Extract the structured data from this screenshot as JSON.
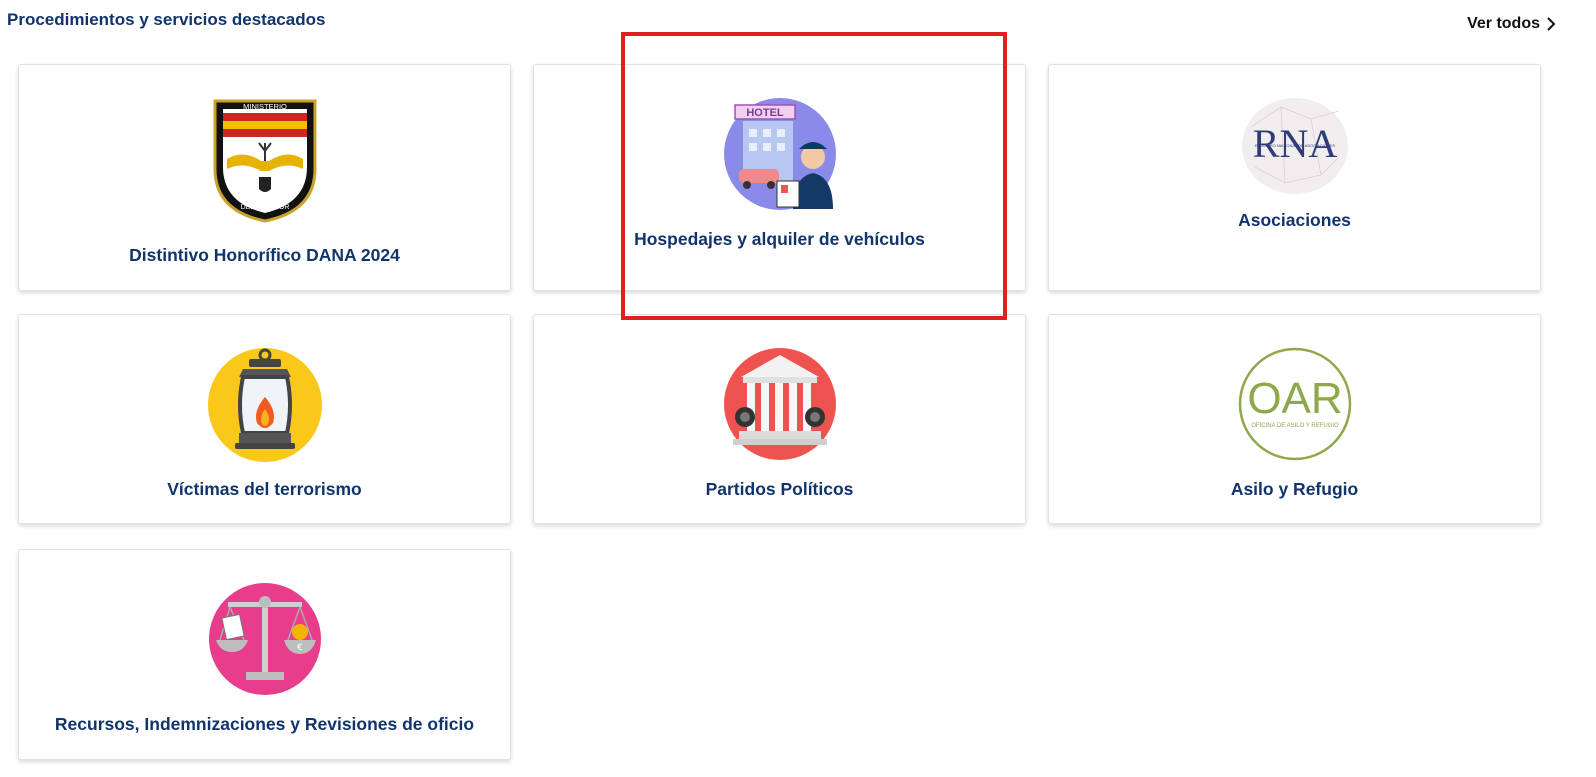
{
  "section": {
    "title": "Procedimientos y servicios destacados",
    "see_all": "Ver todos"
  },
  "cards": [
    {
      "label": "Distintivo Honorífico DANA 2024",
      "icon": "ministerio-interior-badge-icon",
      "badge_top": "MINISTERIO",
      "badge_bottom": "DEL INTERIOR"
    },
    {
      "label": "Hospedajes y alquiler de vehículos",
      "icon": "hotel-vehicle-icon",
      "sign": "HOTEL"
    },
    {
      "label": "Asociaciones",
      "icon": "rna-logo-icon",
      "logo_text": "RNA",
      "logo_sub": "REGISTRO NACIONAL DE ASOCIACIONES"
    },
    {
      "label": "Víctimas del terrorismo",
      "icon": "lantern-icon"
    },
    {
      "label": "Partidos Políticos",
      "icon": "parliament-building-icon"
    },
    {
      "label": "Asilo y Refugio",
      "icon": "oar-logo-icon",
      "logo_text": "OAR",
      "logo_sub": "OFICINA DE ASILO Y REFUGIO"
    },
    {
      "label": "Recursos, Indemnizaciones y Revisiones de oficio",
      "icon": "scales-icon"
    }
  ],
  "colors": {
    "title": "#12346c",
    "highlight": "#e02020"
  }
}
